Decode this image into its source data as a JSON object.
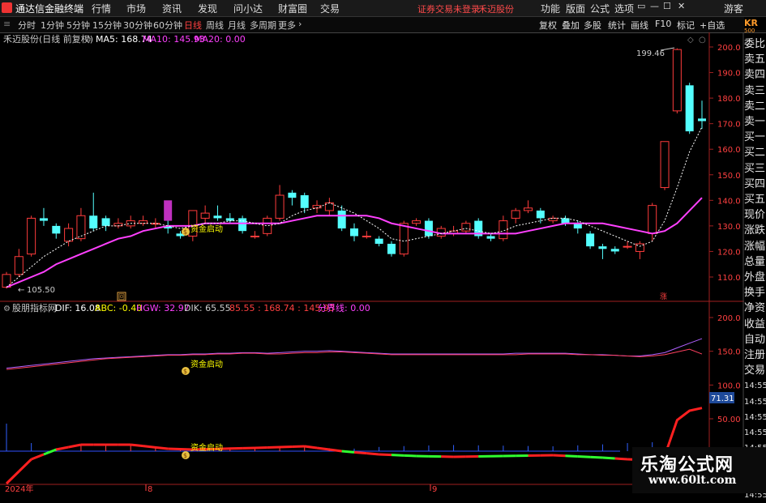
{
  "app": {
    "title": "通达信金融终端",
    "menu": [
      "行情",
      "市场",
      "资讯",
      "发现",
      "问小达",
      "财富圈",
      "交易"
    ],
    "warning": "证券交易未登录",
    "stock_link": "禾迈股份",
    "right_menu": [
      "功能",
      "版面",
      "公式",
      "选项"
    ],
    "guest": "游客",
    "window_buttons": [
      "▭",
      "—",
      "☐",
      "✕"
    ]
  },
  "toolbar": {
    "periods": [
      "分时",
      "1分钟",
      "5分钟",
      "15分钟",
      "30分钟",
      "60分钟",
      "日线",
      "周线",
      "月线",
      "多周期",
      "更多"
    ],
    "active_period": "日线",
    "right": [
      "复权",
      "叠加",
      "多股",
      "统计",
      "画线",
      "F10",
      "标记",
      "+自选"
    ]
  },
  "main_panel": {
    "stock": "禾迈股份(日线 前复权)",
    "ma5_label": "MA5: 168.74",
    "ma10_label": "MA10: 145.93",
    "ma20_label": "MA20: 0.00",
    "y_ticks": [
      "200.0",
      "190.0",
      "180.0",
      "170.0",
      "160.0",
      "150.0",
      "140.0",
      "130.0",
      "120.0",
      "110.0"
    ],
    "high_label": "199.46",
    "low_label": "105.50",
    "signal_text": "资金启动",
    "marker_left": "回",
    "marker_right": "涨"
  },
  "indicator_panel": {
    "name": "股朋指标网",
    "dif": "DIF: 16.08",
    "abc": "ABC: -0.40",
    "hgw": "HGW: 32.97",
    "dik": "DIK: 65.55",
    "vals": "85.55 : 168.74 : 145.93",
    "fenjie": "分界线: 0.00",
    "y_ticks": [
      "200.0",
      "150.0",
      "100.0",
      "50.00"
    ],
    "current_value": "71.31",
    "signal_text": "资金启动"
  },
  "x_axis": {
    "labels": [
      "2024年",
      "8",
      "9"
    ]
  },
  "side_panel": {
    "logo": "KR",
    "sub": "500",
    "labels": [
      "委比",
      "卖五",
      "卖四",
      "卖三",
      "卖二",
      "卖一",
      "买一",
      "买二",
      "买三",
      "买四",
      "买五",
      "现价",
      "涨跌",
      "涨幅",
      "总量",
      "外盘",
      "换手",
      "净资",
      "收益",
      "自动",
      "注册",
      "交易",
      "14:55",
      "14:55",
      "14:55",
      "14:55",
      "14:55",
      "14:55",
      "14:55",
      "14:55"
    ]
  },
  "watermark": {
    "line1": "乐淘公式网",
    "line2": "www.60lt.com"
  },
  "colors": {
    "up": "#ff3c3c",
    "down": "#54ffff",
    "ma5": "#ffffff",
    "ma10": "#ff40ff",
    "signal": "#ffff00"
  },
  "chart_data": {
    "type": "candlestick",
    "price_range": [
      105,
      203
    ],
    "candles": [
      {
        "o": 106,
        "c": 111,
        "h": 112,
        "l": 105.5
      },
      {
        "o": 111,
        "c": 118,
        "h": 121,
        "l": 110
      },
      {
        "o": 119,
        "c": 133,
        "h": 134,
        "l": 118
      },
      {
        "o": 133,
        "c": 132,
        "h": 137,
        "l": 130
      },
      {
        "o": 130,
        "c": 127,
        "h": 131,
        "l": 125
      },
      {
        "o": 124,
        "c": 129,
        "h": 131,
        "l": 122
      },
      {
        "o": 125,
        "c": 134,
        "h": 137,
        "l": 124
      },
      {
        "o": 134,
        "c": 129,
        "h": 143,
        "l": 128
      },
      {
        "o": 133,
        "c": 130,
        "h": 134,
        "l": 128
      },
      {
        "o": 130,
        "c": 131,
        "h": 133,
        "l": 129
      },
      {
        "o": 130,
        "c": 132,
        "h": 134,
        "l": 129
      },
      {
        "o": 131,
        "c": 132,
        "h": 134,
        "l": 130
      },
      {
        "o": 131,
        "c": 131,
        "h": 133,
        "l": 129
      },
      {
        "o": 130,
        "c": 129,
        "h": 132,
        "l": 127
      },
      {
        "o": 127,
        "c": 126,
        "h": 128,
        "l": 125
      },
      {
        "o": 126,
        "c": 136,
        "h": 136,
        "l": 124
      },
      {
        "o": 133,
        "c": 135,
        "h": 138,
        "l": 131
      },
      {
        "o": 134,
        "c": 133,
        "h": 138,
        "l": 132
      },
      {
        "o": 133,
        "c": 132,
        "h": 135,
        "l": 131
      },
      {
        "o": 133,
        "c": 128,
        "h": 134,
        "l": 127
      },
      {
        "o": 126,
        "c": 126,
        "h": 128,
        "l": 125
      },
      {
        "o": 127,
        "c": 133,
        "h": 134,
        "l": 126
      },
      {
        "o": 133,
        "c": 142,
        "h": 146,
        "l": 132
      },
      {
        "o": 143,
        "c": 141,
        "h": 144,
        "l": 138
      },
      {
        "o": 142,
        "c": 137,
        "h": 143,
        "l": 135
      },
      {
        "o": 137,
        "c": 138,
        "h": 140,
        "l": 135
      },
      {
        "o": 136,
        "c": 139,
        "h": 141,
        "l": 134
      },
      {
        "o": 136,
        "c": 129,
        "h": 138,
        "l": 128
      },
      {
        "o": 129,
        "c": 126,
        "h": 131,
        "l": 124
      },
      {
        "o": 126,
        "c": 126,
        "h": 128,
        "l": 125
      },
      {
        "o": 125,
        "c": 123,
        "h": 126,
        "l": 122
      },
      {
        "o": 123,
        "c": 119,
        "h": 124,
        "l": 118
      },
      {
        "o": 119,
        "c": 131,
        "h": 132,
        "l": 118
      },
      {
        "o": 131,
        "c": 132,
        "h": 133,
        "l": 130
      },
      {
        "o": 132,
        "c": 126,
        "h": 133,
        "l": 125
      },
      {
        "o": 126,
        "c": 129,
        "h": 130,
        "l": 125
      },
      {
        "o": 127,
        "c": 128,
        "h": 130,
        "l": 126
      },
      {
        "o": 128,
        "c": 131,
        "h": 132,
        "l": 127
      },
      {
        "o": 132,
        "c": 126,
        "h": 133,
        "l": 125
      },
      {
        "o": 126,
        "c": 125,
        "h": 127,
        "l": 124
      },
      {
        "o": 125,
        "c": 132,
        "h": 134,
        "l": 124
      },
      {
        "o": 133,
        "c": 136,
        "h": 137,
        "l": 131
      },
      {
        "o": 136,
        "c": 137,
        "h": 140,
        "l": 135
      },
      {
        "o": 136,
        "c": 133,
        "h": 137,
        "l": 131
      },
      {
        "o": 132,
        "c": 133,
        "h": 134,
        "l": 131
      },
      {
        "o": 133,
        "c": 131,
        "h": 134,
        "l": 130
      },
      {
        "o": 131,
        "c": 129,
        "h": 132,
        "l": 127
      },
      {
        "o": 127,
        "c": 122,
        "h": 128,
        "l": 121
      },
      {
        "o": 122,
        "c": 121,
        "h": 123,
        "l": 117
      },
      {
        "o": 121,
        "c": 120,
        "h": 122,
        "l": 119
      },
      {
        "o": 122,
        "c": 122,
        "h": 124,
        "l": 121
      },
      {
        "o": 120,
        "c": 123,
        "h": 124,
        "l": 117
      },
      {
        "o": 127,
        "c": 138,
        "h": 139,
        "l": 124
      },
      {
        "o": 145,
        "c": 163,
        "h": 163,
        "l": 144
      },
      {
        "o": 175,
        "c": 199,
        "h": 199.46,
        "l": 174
      },
      {
        "o": 185,
        "c": 167,
        "h": 186,
        "l": 166
      },
      {
        "o": 172,
        "c": 171,
        "h": 179,
        "l": 168
      }
    ],
    "ma5": [
      106,
      110,
      114,
      118,
      121,
      124,
      126,
      128,
      130,
      130,
      131,
      131,
      131,
      130,
      129,
      130,
      131,
      131,
      132,
      132,
      131,
      130,
      131,
      134,
      136,
      137,
      139,
      137,
      135,
      132,
      129,
      125,
      124,
      125,
      126,
      127,
      128,
      129,
      128,
      127,
      128,
      130,
      131,
      132,
      133,
      133,
      132,
      130,
      128,
      126,
      124,
      122,
      124,
      132,
      145,
      159,
      168.74
    ],
    "ma10": [
      106,
      108,
      110,
      112,
      115,
      117,
      119,
      121,
      123,
      125,
      126,
      128,
      129,
      130,
      130,
      130,
      131,
      131,
      131,
      131,
      131,
      131,
      131,
      132,
      133,
      134,
      134,
      134,
      134,
      134,
      133,
      131,
      130,
      129,
      128,
      127,
      127,
      127,
      127,
      127,
      127,
      127,
      128,
      129,
      130,
      131,
      131,
      131,
      131,
      130,
      129,
      128,
      127,
      128,
      131,
      136,
      141,
      145.93
    ],
    "signal_index": 13,
    "ind_upper": [
      125,
      127,
      129,
      131,
      133,
      135,
      137,
      139,
      140,
      141,
      142,
      143,
      144,
      145,
      145,
      146,
      146,
      147,
      147,
      148,
      148,
      147,
      148,
      149,
      150,
      150,
      151,
      150,
      149,
      148,
      147,
      146,
      146,
      146,
      146,
      146,
      146,
      146,
      146,
      146,
      146,
      147,
      147,
      147,
      147,
      147,
      146,
      145,
      145,
      144,
      143,
      143,
      145,
      148,
      155,
      162,
      168.74
    ],
    "ind_lower": [
      123,
      125,
      127,
      129,
      131,
      133,
      135,
      137,
      139,
      140,
      141,
      142,
      143,
      144,
      144,
      145,
      145,
      146,
      146,
      147,
      147,
      146,
      146,
      147,
      148,
      148,
      149,
      149,
      148,
      147,
      146,
      145,
      145,
      145,
      145,
      145,
      145,
      145,
      145,
      145,
      145,
      145,
      146,
      146,
      146,
      146,
      145,
      145,
      144,
      144,
      143,
      142,
      143,
      145,
      149,
      153,
      145.93
    ],
    "dik_line": [
      [
        0,
        -40
      ],
      [
        2,
        -10
      ],
      [
        4,
        2
      ],
      [
        6,
        8
      ],
      [
        10,
        8
      ],
      [
        13,
        3
      ],
      [
        15,
        2
      ],
      [
        20,
        4
      ],
      [
        24,
        6
      ],
      [
        27,
        0
      ],
      [
        30,
        -4
      ],
      [
        33,
        -6
      ],
      [
        36,
        -7
      ],
      [
        40,
        -6
      ],
      [
        44,
        -5
      ],
      [
        48,
        -8
      ],
      [
        50,
        -10
      ],
      [
        53,
        -12
      ],
      [
        54,
        -40
      ],
      [
        55,
        -70
      ],
      [
        56,
        -75
      ]
    ],
    "hgw_series": [
      32.97
    ],
    "dif": 16.08,
    "abc": -0.4,
    "dik": 65.55
  }
}
